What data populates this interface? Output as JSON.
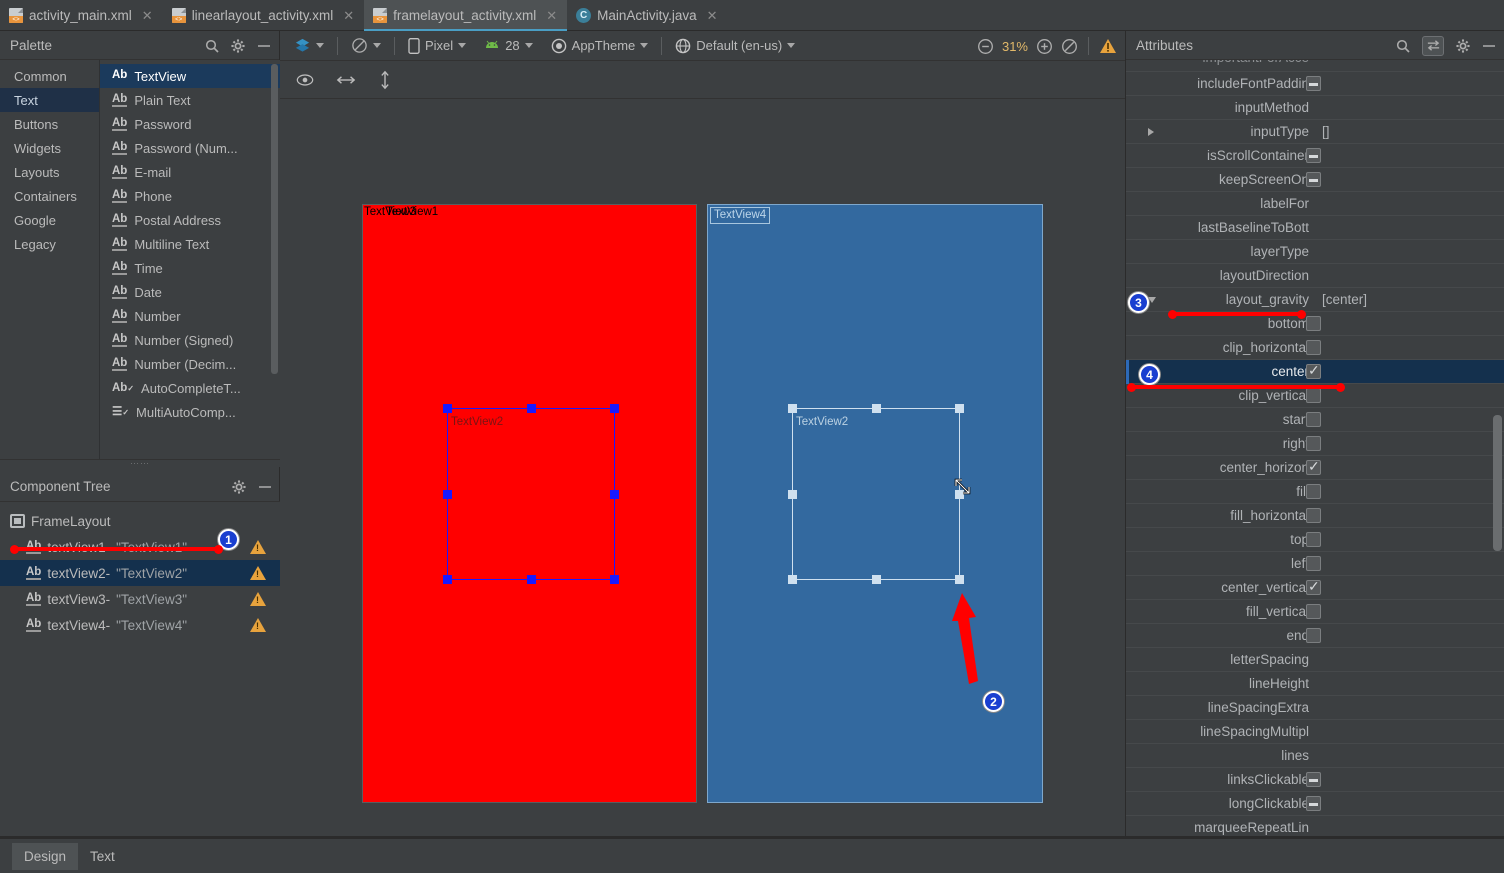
{
  "tabs": [
    {
      "label": "activity_main.xml",
      "icon": "xml-file-icon",
      "active": false
    },
    {
      "label": "linearlayout_activity.xml",
      "icon": "xml-file-icon",
      "active": false
    },
    {
      "label": "framelayout_activity.xml",
      "icon": "xml-file-icon",
      "active": true
    },
    {
      "label": "MainActivity.java",
      "icon": "java-class-icon",
      "active": false
    }
  ],
  "palette": {
    "title": "Palette",
    "search_icon": "search-icon",
    "gear_icon": "gear-icon",
    "minimize_icon": "minimize-icon",
    "categories": [
      {
        "label": "Common",
        "selected": false
      },
      {
        "label": "Text",
        "selected": true
      },
      {
        "label": "Buttons",
        "selected": false
      },
      {
        "label": "Widgets",
        "selected": false
      },
      {
        "label": "Layouts",
        "selected": false
      },
      {
        "label": "Containers",
        "selected": false
      },
      {
        "label": "Google",
        "selected": false
      },
      {
        "label": "Legacy",
        "selected": false
      }
    ],
    "items": [
      {
        "label": "TextView",
        "selected": true
      },
      {
        "label": "Plain Text",
        "selected": false
      },
      {
        "label": "Password",
        "selected": false
      },
      {
        "label": "Password (Num...",
        "selected": false
      },
      {
        "label": "E-mail",
        "selected": false
      },
      {
        "label": "Phone",
        "selected": false
      },
      {
        "label": "Postal Address",
        "selected": false
      },
      {
        "label": "Multiline Text",
        "selected": false
      },
      {
        "label": "Time",
        "selected": false
      },
      {
        "label": "Date",
        "selected": false
      },
      {
        "label": "Number",
        "selected": false
      },
      {
        "label": "Number (Signed)",
        "selected": false
      },
      {
        "label": "Number (Decim...",
        "selected": false
      },
      {
        "label": "AutoCompleteT...",
        "selected": false
      },
      {
        "label": "MultiAutoComp...",
        "selected": false
      }
    ]
  },
  "component_tree": {
    "title": "Component Tree",
    "gear_icon": "gear-icon",
    "minimize_icon": "minimize-icon",
    "nodes": [
      {
        "name": "FrameLayout",
        "value": "",
        "selected": false,
        "warning": false,
        "root": true
      },
      {
        "name": "textView1-",
        "value": "\"TextView1\"",
        "selected": false,
        "warning": true,
        "root": false
      },
      {
        "name": "textView2-",
        "value": "\"TextView2\"",
        "selected": true,
        "warning": true,
        "root": false
      },
      {
        "name": "textView3-",
        "value": "\"TextView3\"",
        "selected": false,
        "warning": true,
        "root": false
      },
      {
        "name": "textView4-",
        "value": "\"TextView4\"",
        "selected": false,
        "warning": true,
        "root": false
      }
    ]
  },
  "toolbar": {
    "design_mode_icon": "layers-icon",
    "orientation_icon": "rotate-device-icon",
    "device_icon": "phone-icon",
    "device_label": "Pixel",
    "api_icon": "android-icon",
    "api_label": "28",
    "theme_icon": "theme-icon",
    "theme_label": "AppTheme",
    "locale_icon": "globe-icon",
    "locale_label": "Default (en-us)",
    "zoom_out_icon": "zoom-out-icon",
    "zoom_level": "31%",
    "zoom_in_icon": "zoom-in-icon",
    "zoom_fit_icon": "zoom-fit-icon",
    "warning_icon": "warning-icon"
  },
  "toolbar2": {
    "show_icon": "eye-icon",
    "horizontal_icon": "horizontal-arrows-icon",
    "vertical_icon": "vertical-arrows-icon"
  },
  "canvas": {
    "red_preview": {
      "top_label": "TextView3",
      "top_label_overlap": "TextView1",
      "selected_label": "TextView2"
    },
    "blue_preview": {
      "top_label": "TextView4",
      "top_label_overlap": "TextView2",
      "selected_label": "TextView2",
      "resize_cursor_icon": "resize-diagonal-cursor-icon"
    }
  },
  "annotations": [
    {
      "id": "1",
      "number": "1"
    },
    {
      "id": "2",
      "number": "2"
    },
    {
      "id": "3",
      "number": "3"
    },
    {
      "id": "4",
      "number": "4"
    }
  ],
  "attributes": {
    "title": "Attributes",
    "search_icon": "search-icon",
    "toggle_icon": "swap-arrows-icon",
    "gear_icon": "gear-icon",
    "minimize_icon": "minimize-icon",
    "rows": [
      {
        "label": "importantForAcce",
        "value": "",
        "control": "none",
        "indent": 0,
        "selected": false,
        "partial": true
      },
      {
        "label": "includeFontPaddin",
        "value": "",
        "control": "tristate",
        "indent": 0,
        "selected": false
      },
      {
        "label": "inputMethod",
        "value": "",
        "control": "none",
        "indent": 0,
        "selected": false
      },
      {
        "label": "inputType",
        "value": "[]",
        "control": "none",
        "indent": 0,
        "selected": false,
        "expander": "right"
      },
      {
        "label": "isScrollContainer",
        "value": "",
        "control": "tristate",
        "indent": 0,
        "selected": false
      },
      {
        "label": "keepScreenOn",
        "value": "",
        "control": "tristate",
        "indent": 0,
        "selected": false
      },
      {
        "label": "labelFor",
        "value": "",
        "control": "none",
        "indent": 0,
        "selected": false
      },
      {
        "label": "lastBaselineToBott",
        "value": "",
        "control": "none",
        "indent": 0,
        "selected": false
      },
      {
        "label": "layerType",
        "value": "",
        "control": "none",
        "indent": 0,
        "selected": false
      },
      {
        "label": "layoutDirection",
        "value": "",
        "control": "none",
        "indent": 0,
        "selected": false
      },
      {
        "label": "layout_gravity",
        "value": "[center]",
        "control": "none",
        "indent": 0,
        "selected": false,
        "expander": "down"
      },
      {
        "label": "bottom",
        "value": "",
        "control": "unchecked",
        "indent": 1,
        "selected": false
      },
      {
        "label": "clip_horizontal",
        "value": "",
        "control": "unchecked",
        "indent": 1,
        "selected": false
      },
      {
        "label": "center",
        "value": "",
        "control": "checked",
        "indent": 1,
        "selected": true
      },
      {
        "label": "clip_vertical",
        "value": "",
        "control": "unchecked",
        "indent": 1,
        "selected": false
      },
      {
        "label": "start",
        "value": "",
        "control": "unchecked",
        "indent": 1,
        "selected": false
      },
      {
        "label": "right",
        "value": "",
        "control": "unchecked",
        "indent": 1,
        "selected": false
      },
      {
        "label": "center_horizon",
        "value": "",
        "control": "checked",
        "indent": 1,
        "selected": false
      },
      {
        "label": "fill",
        "value": "",
        "control": "unchecked",
        "indent": 1,
        "selected": false
      },
      {
        "label": "fill_horizontal",
        "value": "",
        "control": "unchecked",
        "indent": 1,
        "selected": false
      },
      {
        "label": "top",
        "value": "",
        "control": "unchecked",
        "indent": 1,
        "selected": false
      },
      {
        "label": "left",
        "value": "",
        "control": "unchecked",
        "indent": 1,
        "selected": false
      },
      {
        "label": "center_vertical",
        "value": "",
        "control": "checked",
        "indent": 1,
        "selected": false
      },
      {
        "label": "fill_vertical",
        "value": "",
        "control": "unchecked",
        "indent": 1,
        "selected": false
      },
      {
        "label": "end",
        "value": "",
        "control": "unchecked",
        "indent": 1,
        "selected": false
      },
      {
        "label": "letterSpacing",
        "value": "",
        "control": "none",
        "indent": 0,
        "selected": false
      },
      {
        "label": "lineHeight",
        "value": "",
        "control": "none",
        "indent": 0,
        "selected": false
      },
      {
        "label": "lineSpacingExtra",
        "value": "",
        "control": "none",
        "indent": 0,
        "selected": false
      },
      {
        "label": "lineSpacingMultipl",
        "value": "",
        "control": "none",
        "indent": 0,
        "selected": false
      },
      {
        "label": "lines",
        "value": "",
        "control": "none",
        "indent": 0,
        "selected": false
      },
      {
        "label": "linksClickable",
        "value": "",
        "control": "tristate",
        "indent": 0,
        "selected": false
      },
      {
        "label": "longClickable",
        "value": "",
        "control": "tristate",
        "indent": 0,
        "selected": false
      },
      {
        "label": "marqueeRepeatLin",
        "value": "",
        "control": "none",
        "indent": 0,
        "selected": false
      }
    ]
  },
  "bottom_tabs": [
    {
      "label": "Design",
      "active": true
    },
    {
      "label": "Text",
      "active": false
    }
  ],
  "colors": {
    "accent_blue": "#2d6ab8",
    "selection_blue": "#14304d",
    "panel_bg": "#3c3f41",
    "red_preview": "#ff0000",
    "blue_preview": "#33699f",
    "annotation_red": "#ff0000",
    "warning_orange": "#e8a33d"
  }
}
